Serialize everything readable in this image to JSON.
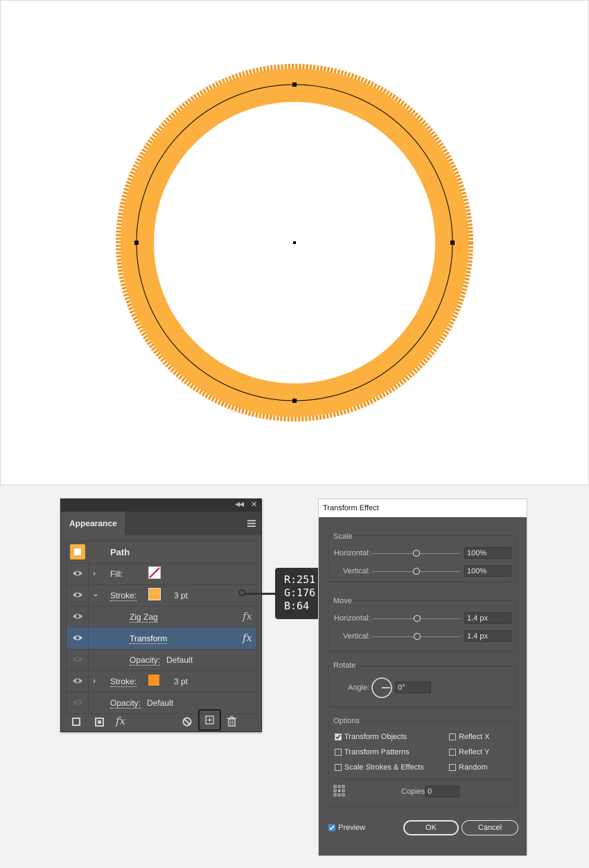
{
  "appearance": {
    "tab_label": "Appearance",
    "header_label": "Path",
    "fill_label": "Fill:",
    "stroke_label": "Stroke:",
    "stroke_weight": "3 pt",
    "zigzag_label": "Zig Zag",
    "transform_label": "Transform",
    "opacity_label": "Opacity:",
    "opacity_value": "Default",
    "stroke2_label": "Stroke:",
    "stroke2_weight": "3 pt",
    "opacity2_label": "Opacity:",
    "opacity2_value": "Default",
    "fx_glyph": "fx",
    "stroke_color": "#fbb040",
    "stroke2_color": "#f7941d"
  },
  "tooltip": {
    "r": "R:251",
    "g": "G:176",
    "b": "B:64"
  },
  "dialog": {
    "title": "Transform Effect",
    "scale_title": "Scale",
    "scale_h_label": "Horizontal:",
    "scale_h_value": "100%",
    "scale_v_label": "Vertical:",
    "scale_v_value": "100%",
    "move_title": "Move",
    "move_h_label": "Horizontal:",
    "move_h_value": "1.4 px",
    "move_v_label": "Vertical:",
    "move_v_value": "1.4 px",
    "rotate_title": "Rotate",
    "angle_label": "Angle:",
    "angle_value": "0°",
    "options_title": "Options",
    "transform_objects": "Transform Objects",
    "transform_patterns": "Transform Patterns",
    "scale_strokes": "Scale Strokes & Effects",
    "reflect_x": "Reflect X",
    "reflect_y": "Reflect Y",
    "random": "Random",
    "copies_label": "Copies",
    "copies_value": "0",
    "preview_label": "Preview",
    "ok_label": "OK",
    "cancel_label": "Cancel"
  },
  "colors": {
    "outer_ring": "#f7941d",
    "inner_ring": "#fbb040"
  }
}
